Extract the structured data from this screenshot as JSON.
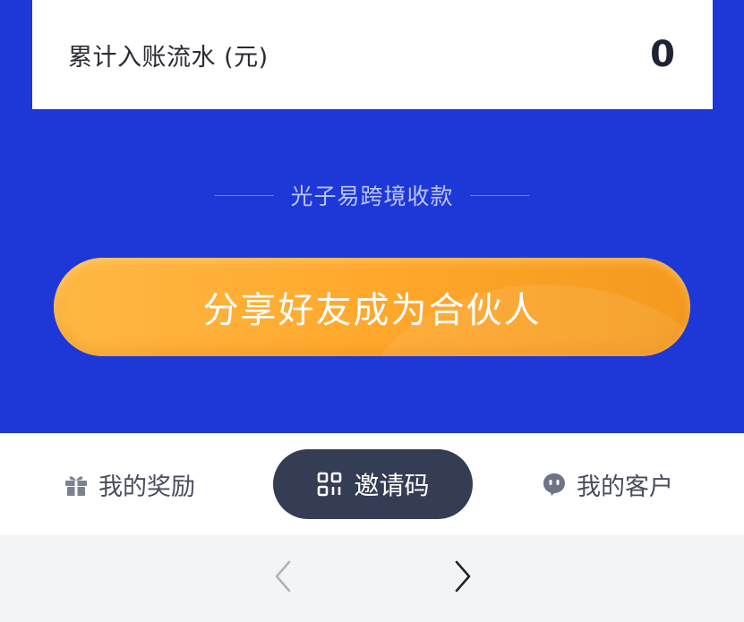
{
  "stat": {
    "label": "累计入账流水 (元)",
    "value": "0"
  },
  "section": {
    "title": "光子易跨境收款"
  },
  "cta": {
    "label": "分享好友成为合伙人"
  },
  "bottom_nav": {
    "rewards": {
      "label": "我的奖励",
      "icon": "gift-icon"
    },
    "invite": {
      "label": "邀请码",
      "icon": "qr-code-icon"
    },
    "customers": {
      "label": "我的客户",
      "icon": "customer-face-icon"
    }
  },
  "browser": {
    "back_icon": "chevron-left-icon",
    "forward_icon": "chevron-right-icon"
  },
  "colors": {
    "primary_blue": "#1e38d8",
    "cta_orange": "#ffa82c",
    "invite_pill": "#353d55",
    "browser_bar": "#f3f4f6"
  }
}
